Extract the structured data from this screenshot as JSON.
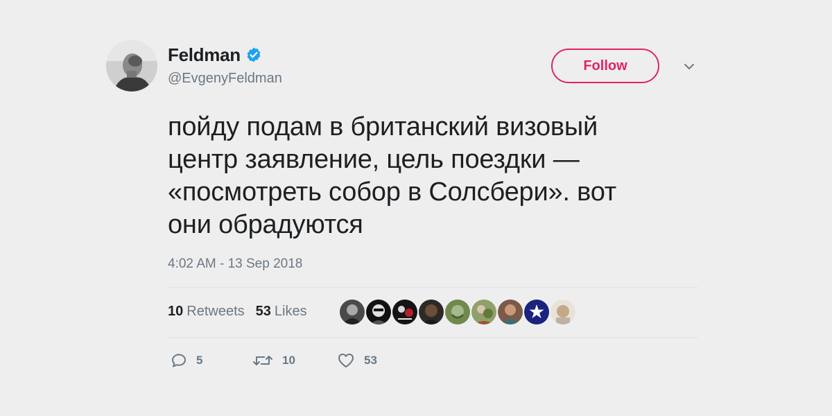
{
  "author": {
    "display_name": "Feldman",
    "handle": "@EvgenyFeldman",
    "verified": true
  },
  "follow_button": {
    "label": "Follow"
  },
  "tweet": {
    "text": "пойду подам в британский визовый\nцентр заявление, цель поездки —\n«посмотреть собор в Солсбери». вот\nони обрадуются",
    "timestamp": "4:02 AM - 13 Sep 2018"
  },
  "stats": {
    "retweets_count": "10",
    "retweets_label": "Retweets",
    "likes_count": "53",
    "likes_label": "Likes"
  },
  "likers_avatars": [
    "avatar-1",
    "avatar-2",
    "avatar-3",
    "avatar-4",
    "avatar-5",
    "avatar-6",
    "avatar-7",
    "avatar-8",
    "avatar-9"
  ],
  "actions": {
    "reply_count": "5",
    "retweet_count": "10",
    "like_count": "53"
  },
  "colors": {
    "accent": "#e0245e",
    "verified": "#1da1f2",
    "text": "#1c2022",
    "muted": "#697882",
    "background": "#efeeef"
  }
}
